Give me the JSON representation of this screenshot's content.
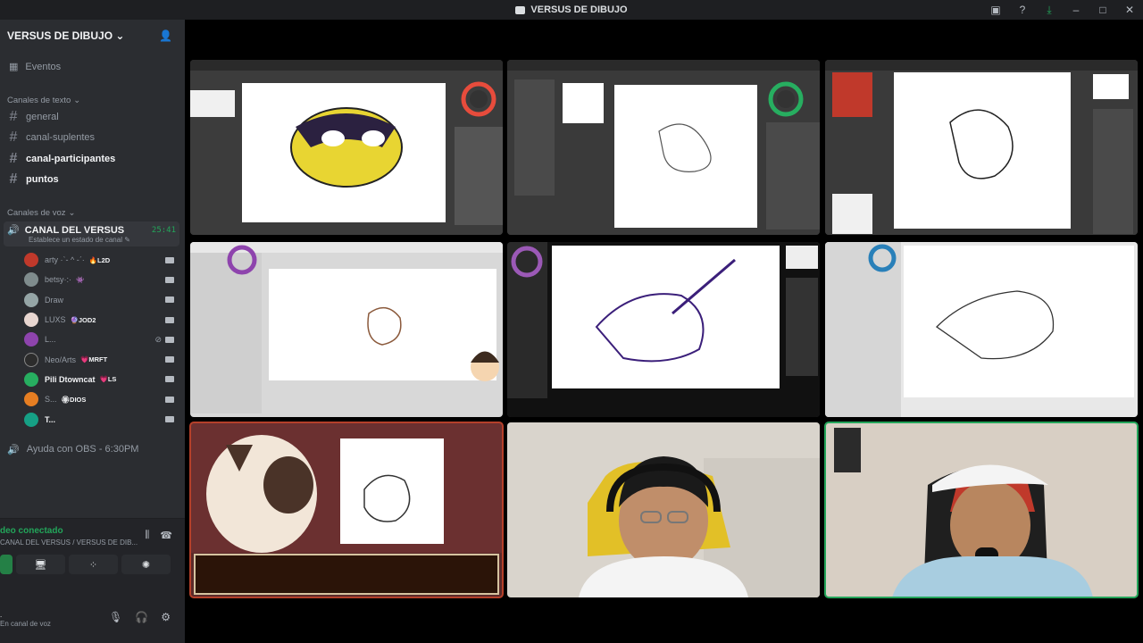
{
  "window": {
    "title": "VERSUS DE DIBUJO"
  },
  "server": {
    "name": "VERSUS DE DIBUJO"
  },
  "events_label": "Eventos",
  "text_category": "Canales de texto",
  "text_channels": [
    {
      "name": "general"
    },
    {
      "name": "canal-suplentes"
    },
    {
      "name": "canal-participantes"
    },
    {
      "name": "puntos"
    }
  ],
  "voice_category": "Canales de voz",
  "voice_channel": {
    "name": "CANAL DEL VERSUS",
    "time": "25:41",
    "status": "Establece un estado de canal"
  },
  "voice_users": [
    {
      "name": "arty ·ˋ- ^ -ˊ·",
      "tag": "🔥L2D",
      "color": "#c0392b"
    },
    {
      "name": "betsy·:·",
      "tag": "👾",
      "color": "#7f8c8d"
    },
    {
      "name": "Draw",
      "tag": "",
      "color": "#95a5a6"
    },
    {
      "name": "LUXS",
      "tag": "🔮JOD2",
      "color": "#e8d6d0"
    },
    {
      "name": "L...",
      "tag": "",
      "color": "#8e44ad"
    },
    {
      "name": "Neo/Arts",
      "tag": "💗MRFT",
      "color": "#2c2c2c"
    },
    {
      "name": "Pili Dtowncat",
      "tag": "💗LS",
      "color": "#27ae60"
    },
    {
      "name": "S...",
      "tag": "🏵DIOS",
      "color": "#e67e22"
    },
    {
      "name": "T...",
      "tag": "",
      "color": "#16a085"
    }
  ],
  "stage_channel": {
    "name": "Ayuda con OBS - 6:30PM"
  },
  "rtc": {
    "state": "deo conectado",
    "location": "CANAL DEL VERSUS / VERSUS DE DIB..."
  },
  "user_panel": {
    "name": ".",
    "status": "En canal de voz"
  },
  "colors": {
    "accent": "#23a55a",
    "sidebar": "#2b2d31",
    "titlebar": "#1e1f22"
  }
}
